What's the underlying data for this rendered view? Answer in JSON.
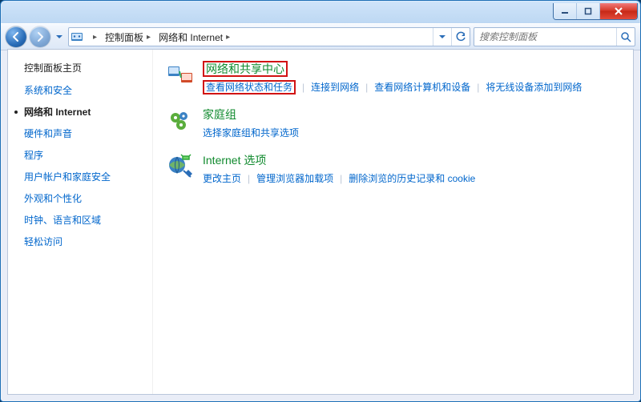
{
  "search": {
    "placeholder": "搜索控制面板"
  },
  "breadcrumb": [
    {
      "label": "控制面板"
    },
    {
      "label": "网络和 Internet"
    }
  ],
  "sidebar": {
    "heading": "控制面板主页",
    "items": [
      {
        "label": "系统和安全",
        "current": false
      },
      {
        "label": "网络和 Internet",
        "current": true
      },
      {
        "label": "硬件和声音",
        "current": false
      },
      {
        "label": "程序",
        "current": false
      },
      {
        "label": "用户帐户和家庭安全",
        "current": false
      },
      {
        "label": "外观和个性化",
        "current": false
      },
      {
        "label": "时钟、语言和区域",
        "current": false
      },
      {
        "label": "轻松访问",
        "current": false
      }
    ]
  },
  "categories": [
    {
      "title": "网络和共享中心",
      "highlight": true,
      "links": [
        {
          "label": "查看网络状态和任务",
          "highlight": true
        },
        {
          "label": "连接到网络"
        },
        {
          "label": "查看网络计算机和设备"
        },
        {
          "label": "将无线设备添加到网络"
        }
      ]
    },
    {
      "title": "家庭组",
      "links": [
        {
          "label": "选择家庭组和共享选项"
        }
      ]
    },
    {
      "title": "Internet 选项",
      "links": [
        {
          "label": "更改主页"
        },
        {
          "label": "管理浏览器加载项"
        },
        {
          "label": "删除浏览的历史记录和 cookie"
        }
      ]
    }
  ]
}
